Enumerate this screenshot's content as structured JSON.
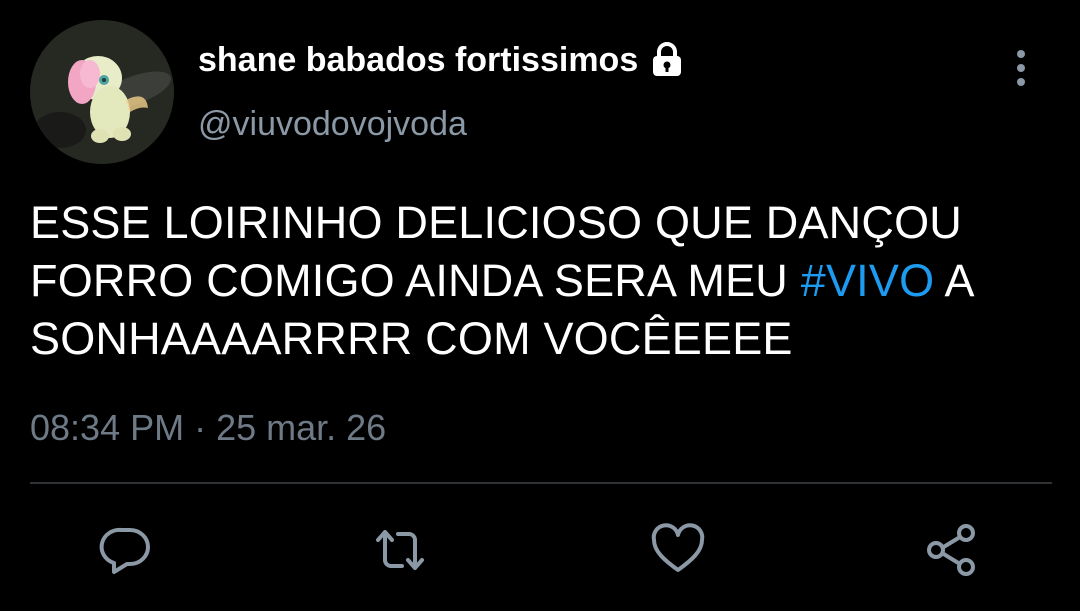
{
  "tweet": {
    "author": {
      "display_name": "shane babados fortissimos",
      "handle": "@viuvodovojvoda",
      "protected_icon": "lock-icon",
      "avatar_icon": "plush-toy-avatar"
    },
    "text_lines": [
      "ESSE LOIRINHO DELICIOSO QUE DANÇOU",
      "FORRO COMIGO AINDA SERA MEU ",
      "#VIVO",
      " A",
      "SONHAAAARRRR COM VOCÊEEEE"
    ],
    "timestamp": "08:34 PM · 25 mar. 26",
    "actions": {
      "reply_icon": "reply-icon",
      "retweet_icon": "retweet-icon",
      "like_icon": "heart-icon",
      "share_icon": "share-icon"
    },
    "more_icon": "more-vertical-icon"
  },
  "colors": {
    "background": "#000000",
    "text": "#ffffff",
    "secondary_text": "#8b98a5",
    "timestamp": "#6e7a86",
    "hashtag": "#1d9bf0",
    "icon": "#8b98a5",
    "divider": "#2f3336"
  }
}
